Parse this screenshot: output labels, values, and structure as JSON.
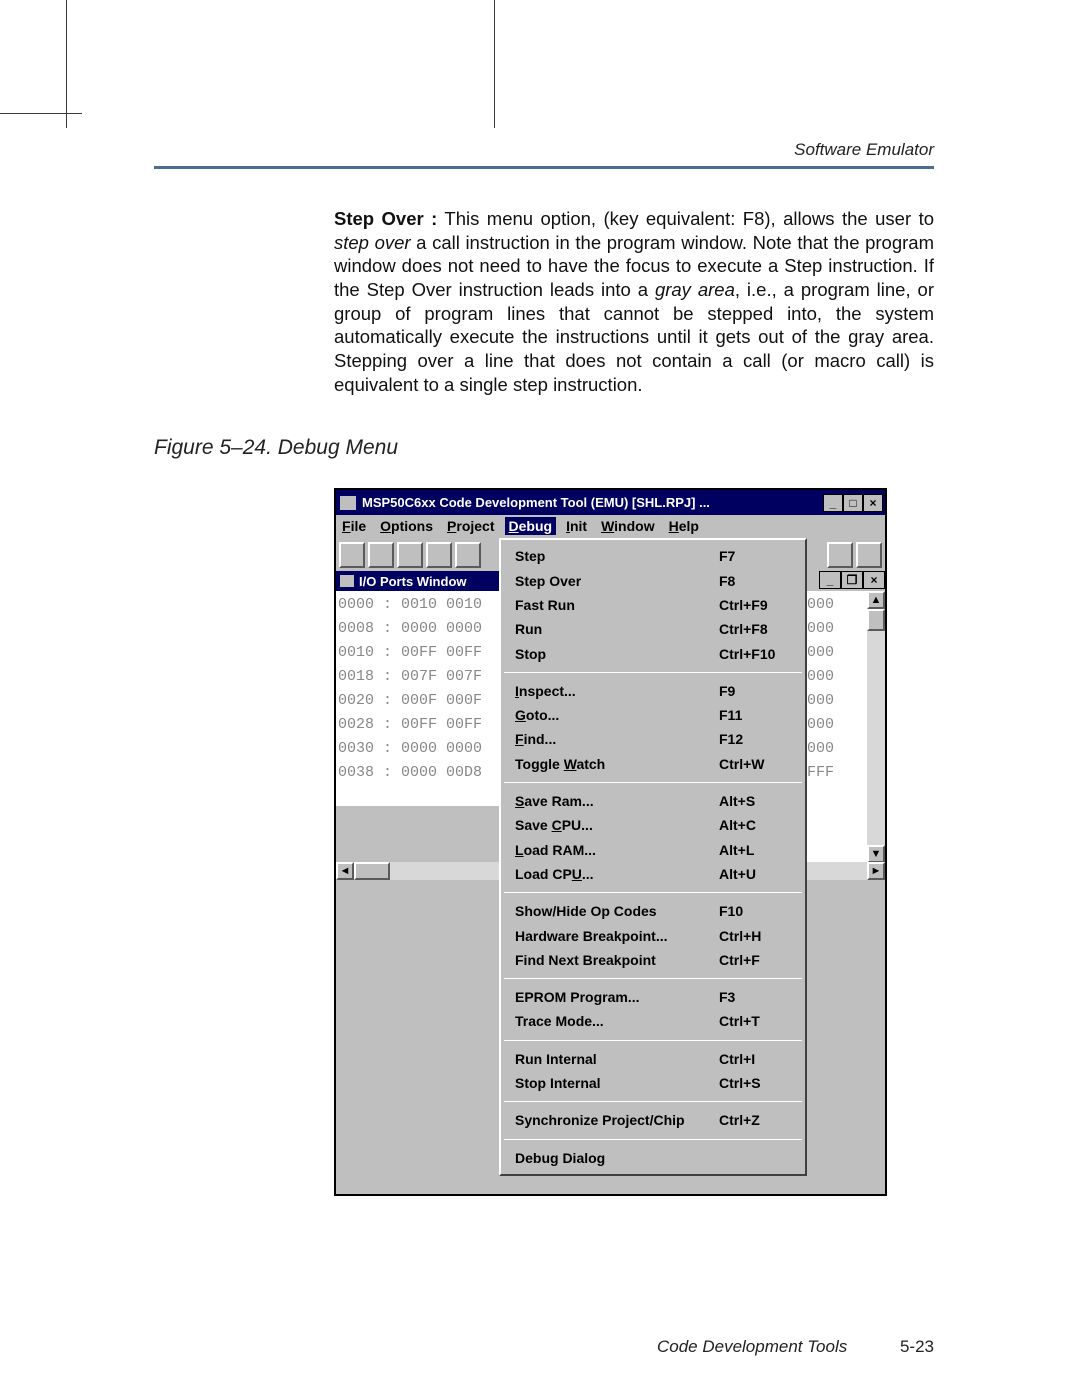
{
  "running_head": "Software Emulator",
  "paragraph_lead": "Step Over :",
  "paragraph_rest_a": " This menu option, (key equivalent: F8), allows the user to ",
  "paragraph_em1": "step over",
  "paragraph_rest_b": " a call instruction in the program window. Note that the program window does not need to have the focus to execute a Step instruction. If the Step Over instruction leads into a ",
  "paragraph_em2": "gray area",
  "paragraph_rest_c": ", i.e., a program line, or group of program lines that cannot be stepped into, the system automatically execute the instructions until it gets out of the gray area. Stepping over a line that does not contain a call (or macro call) is equivalent to a single step instruction.",
  "figure_caption": "Figure 5–24. Debug Menu",
  "window_title": "MSP50C6xx Code Development Tool (EMU) [SHL.RPJ] ...",
  "menubar": [
    {
      "hot": "F",
      "rest": "ile"
    },
    {
      "hot": "O",
      "rest": "ptions"
    },
    {
      "hot": "P",
      "rest": "roject"
    },
    {
      "hot": "D",
      "rest": "ebug",
      "open": true
    },
    {
      "hot": "I",
      "rest": "nit"
    },
    {
      "hot": "W",
      "rest": "indow"
    },
    {
      "hot": "H",
      "rest": "elp"
    }
  ],
  "mdi_title": "I/O Ports Window",
  "ioports_rows": [
    {
      "addr": "0000",
      "a": "0010",
      "b": "0010"
    },
    {
      "addr": "0008",
      "a": "0000",
      "b": "0000"
    },
    {
      "addr": "0010",
      "a": "00FF",
      "b": "00FF"
    },
    {
      "addr": "0018",
      "a": "007F",
      "b": "007F"
    },
    {
      "addr": "0020",
      "a": "000F",
      "b": "000F"
    },
    {
      "addr": "0028",
      "a": "00FF",
      "b": "00FF"
    },
    {
      "addr": "0030",
      "a": "0000",
      "b": "0000"
    },
    {
      "addr": "0038",
      "a": "0000",
      "b": "00D8"
    }
  ],
  "right_rows": [
    "000",
    "000",
    "000",
    "000",
    "000",
    "000",
    "000",
    "FFF"
  ],
  "menu": [
    [
      {
        "label": "Step",
        "hot": "",
        "shortcut": "F7"
      },
      {
        "label": "Step Over",
        "hot": "",
        "shortcut": "F8"
      },
      {
        "label": "Fast Run",
        "hot": "",
        "shortcut": "Ctrl+F9"
      },
      {
        "label": "Run",
        "hot": "",
        "shortcut": "Ctrl+F8"
      },
      {
        "label": "Stop",
        "hot": "",
        "shortcut": "Ctrl+F10"
      }
    ],
    [
      {
        "label": "Inspect...",
        "hot": "I",
        "shortcut": "F9"
      },
      {
        "label": "Goto...",
        "hot": "G",
        "shortcut": "F11"
      },
      {
        "label": "Find...",
        "hot": "F",
        "shortcut": "F12"
      },
      {
        "label": "Toggle Watch",
        "hot": "W",
        "shortcut": "Ctrl+W"
      }
    ],
    [
      {
        "label": "Save Ram...",
        "hot": "S",
        "shortcut": "Alt+S"
      },
      {
        "label": "Save CPU...",
        "hot": "C",
        "shortcut": "Alt+C"
      },
      {
        "label": "Load RAM...",
        "hot": "L",
        "shortcut": "Alt+L"
      },
      {
        "label": "Load CPU...",
        "hot": "U",
        "shortcut": "Alt+U"
      }
    ],
    [
      {
        "label": "Show/Hide Op Codes",
        "hot": "",
        "shortcut": "F10"
      },
      {
        "label": "Hardware Breakpoint...",
        "hot": "",
        "shortcut": "Ctrl+H"
      },
      {
        "label": "Find Next Breakpoint",
        "hot": "",
        "shortcut": "Ctrl+F"
      }
    ],
    [
      {
        "label": "EPROM Program...",
        "hot": "",
        "shortcut": "F3"
      },
      {
        "label": "Trace Mode...",
        "hot": "",
        "shortcut": "Ctrl+T"
      }
    ],
    [
      {
        "label": "Run Internal",
        "hot": "",
        "shortcut": "Ctrl+I"
      },
      {
        "label": "Stop Internal",
        "hot": "",
        "shortcut": "Ctrl+S"
      }
    ],
    [
      {
        "label": "Synchronize Project/Chip",
        "hot": "",
        "shortcut": "Ctrl+Z"
      }
    ],
    [
      {
        "label": "Debug Dialog",
        "hot": "",
        "shortcut": ""
      }
    ]
  ],
  "footer_title": "Code Development Tools",
  "footer_page": "5-23"
}
